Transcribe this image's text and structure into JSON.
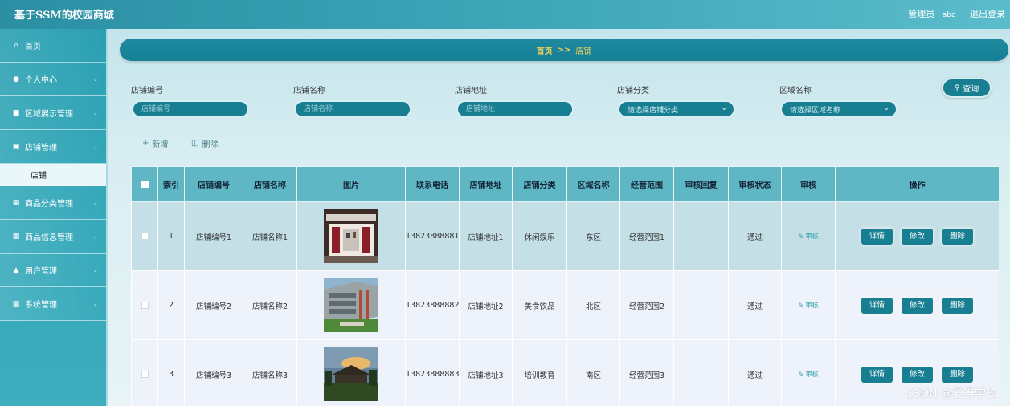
{
  "app": {
    "title": "基于SSM的校园商城"
  },
  "header": {
    "role_label": "管理员",
    "username": "abo",
    "logout_label": "退出登录"
  },
  "sidebar": {
    "items": [
      {
        "label": "首页",
        "icon": "home-icon"
      },
      {
        "label": "个人中心",
        "icon": "user-icon"
      },
      {
        "label": "区域展示管理",
        "icon": "chat-icon"
      },
      {
        "label": "店铺管理",
        "icon": "store-icon"
      },
      {
        "label": "商品分类管理",
        "icon": "grid-icon"
      },
      {
        "label": "商品信息管理",
        "icon": "grid-icon"
      },
      {
        "label": "用户管理",
        "icon": "thumb-icon"
      },
      {
        "label": "系统管理",
        "icon": "grid-icon"
      }
    ],
    "submenu": {
      "label": "店铺"
    }
  },
  "breadcrumb": {
    "home": "首页",
    "separator": ">>",
    "current": "店铺"
  },
  "search": {
    "shop_no": {
      "label": "店铺编号",
      "placeholder": "店铺编号"
    },
    "shop_name": {
      "label": "店铺名称",
      "placeholder": "店铺名称"
    },
    "shop_addr": {
      "label": "店铺地址",
      "placeholder": "店铺地址"
    },
    "shop_cat": {
      "label": "店铺分类",
      "placeholder": "请选择店铺分类"
    },
    "region": {
      "label": "区域名称",
      "placeholder": "请选择区域名称"
    },
    "query_label": "查询"
  },
  "actions": {
    "add_label": "新增",
    "delete_label": "删除"
  },
  "table": {
    "headers": [
      "",
      "索引",
      "店铺编号",
      "店铺名称",
      "图片",
      "联系电话",
      "店铺地址",
      "店铺分类",
      "区域名称",
      "经营范围",
      "审核回复",
      "审核状态",
      "审核",
      "操作"
    ],
    "rows": [
      {
        "index": "1",
        "shop_no": "店铺编号1",
        "shop_name": "店铺名称1",
        "phone": "13823888881",
        "address": "店铺地址1",
        "category": "休闲娱乐",
        "region": "东区",
        "scope": "经营范围1",
        "reply": "",
        "status": "通过",
        "audit": "审核"
      },
      {
        "index": "2",
        "shop_no": "店铺编号2",
        "shop_name": "店铺名称2",
        "phone": "13823888882",
        "address": "店铺地址2",
        "category": "美食饮品",
        "region": "北区",
        "scope": "经营范围2",
        "reply": "",
        "status": "通过",
        "audit": "审核"
      },
      {
        "index": "3",
        "shop_no": "店铺编号3",
        "shop_name": "店铺名称3",
        "phone": "13823888883",
        "address": "店铺地址3",
        "category": "培训教育",
        "region": "南区",
        "scope": "经营范围3",
        "reply": "",
        "status": "通过",
        "audit": "审核"
      }
    ],
    "op_labels": {
      "detail": "详情",
      "edit": "修改",
      "delete": "删除"
    }
  },
  "watermark": "CSDN @爱得学长"
}
